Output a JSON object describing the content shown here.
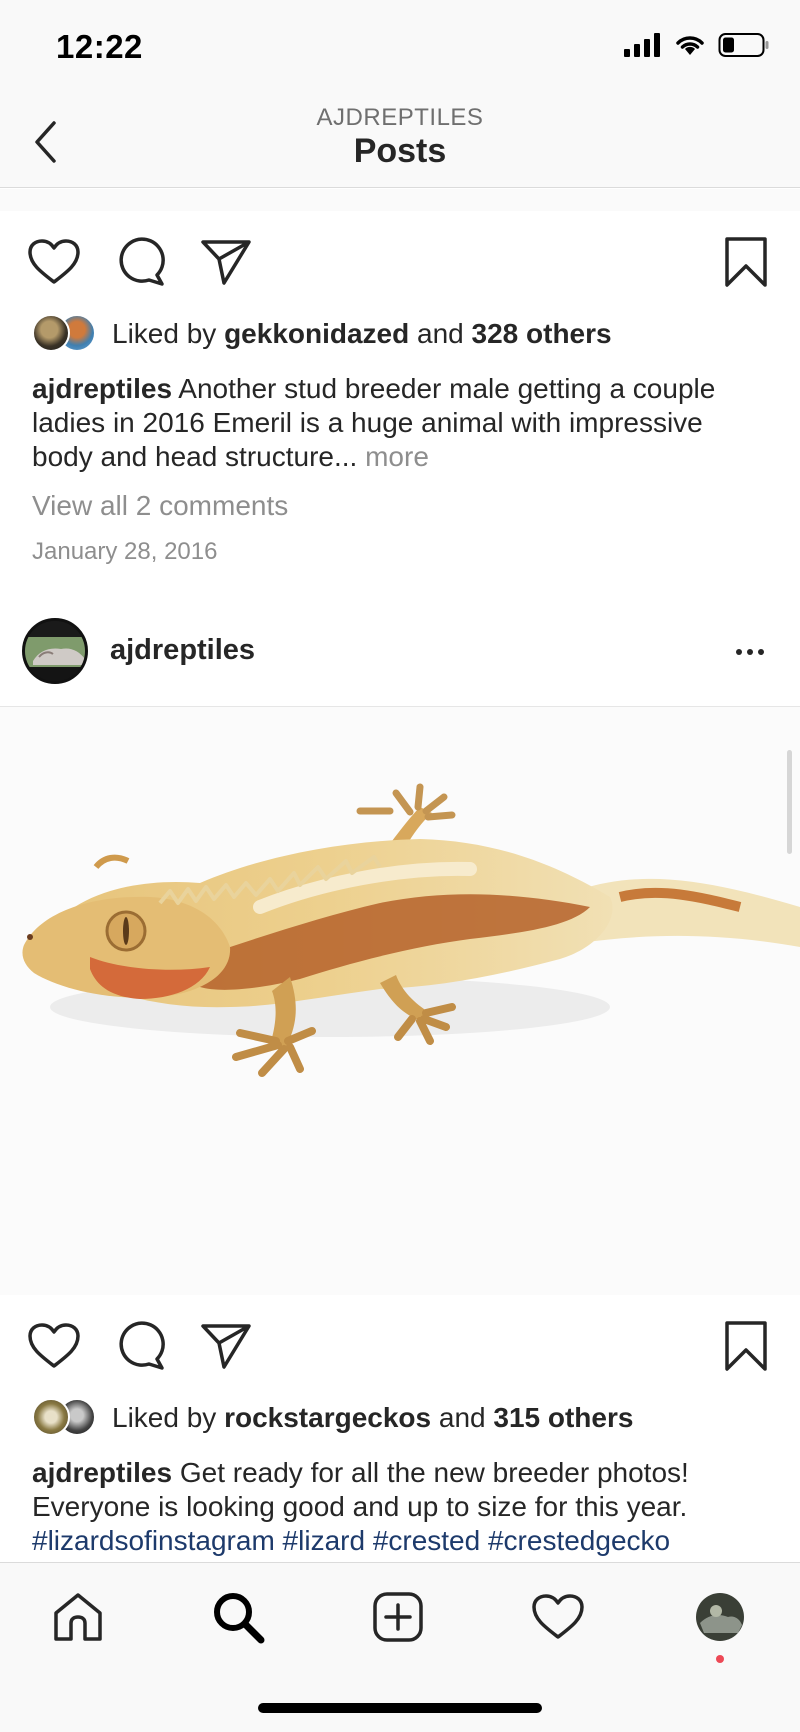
{
  "status": {
    "time": "12:22"
  },
  "header": {
    "account": "AJDREPTILES",
    "title": "Posts"
  },
  "post1": {
    "liked_by_prefix": "Liked by ",
    "liked_by_user": "gekkonidazed",
    "liked_and": " and ",
    "liked_others": "328 others",
    "caption_user": "ajdreptiles",
    "caption_text": " Another stud breeder male getting a couple ladies in 2016 Emeril is a huge animal with impressive body and head structure...",
    "more_label": " more",
    "view_comments": "View all 2 comments",
    "date": "January 28, 2016"
  },
  "post2": {
    "username": "ajdreptiles",
    "image_icon": "crested-gecko-photo",
    "liked_by_prefix": "Liked by ",
    "liked_by_user": "rockstargeckos",
    "liked_and": " and ",
    "liked_others": "315 others",
    "caption_user": "ajdreptiles",
    "caption_text": " Get ready for all the new breeder photos! Everyone is looking good and up to size for this year. ",
    "hashtags": "#lizardsofinstagram #lizard #crested #crestedgecko"
  },
  "icons": {
    "back": "chevron-left-icon",
    "like": "heart-icon",
    "comment": "comment-icon",
    "share": "send-icon",
    "save": "bookmark-icon",
    "more": "more-horizontal-icon",
    "tab_home": "home-icon",
    "tab_search": "search-icon",
    "tab_add": "add-post-icon",
    "tab_activity": "heart-icon",
    "tab_profile": "profile-avatar"
  },
  "colors": {
    "hashtag": "#1d3a6b",
    "notification_dot": "#ed4956",
    "muted_text": "#8e8e8e"
  }
}
